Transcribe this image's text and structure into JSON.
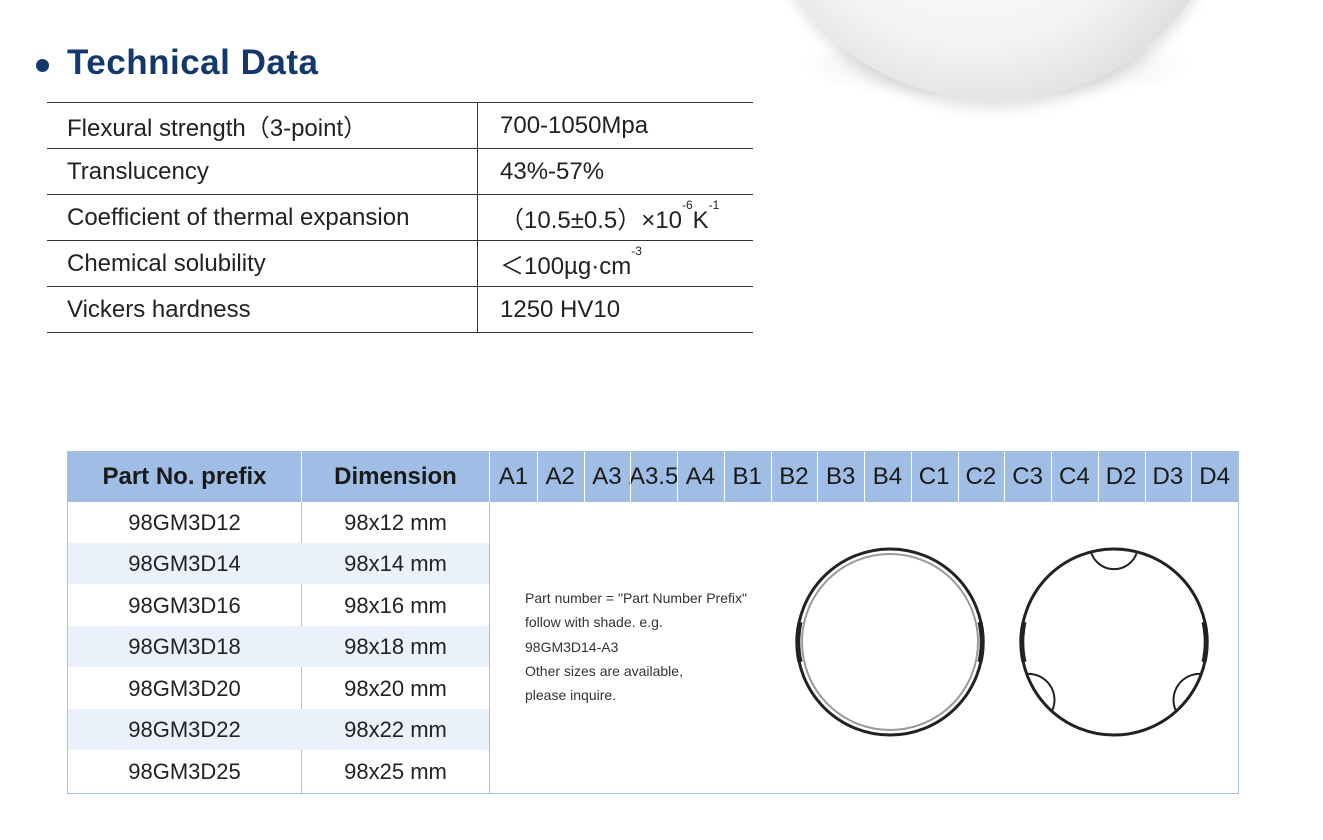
{
  "section": {
    "title": "Technical Data"
  },
  "technical_data": [
    {
      "property": "Flexural strength（3-point）",
      "value": "700-1050Mpa"
    },
    {
      "property": "Translucency",
      "value": "43%-57%"
    },
    {
      "property": "Coefficient of thermal expansion",
      "value_main": "（10.5±0.5）×10",
      "value_sup1": "-6",
      "value_unit": "K",
      "value_sup2": "-1"
    },
    {
      "property": "Chemical solubility",
      "value_main": "＜100µg·cm",
      "value_sup1": "-3"
    },
    {
      "property": "Vickers hardness",
      "value": "1250 HV10"
    }
  ],
  "parts_table": {
    "headers": {
      "prefix": "Part No. prefix",
      "dimension": "Dimension"
    },
    "shades": [
      "A1",
      "A2",
      "A3",
      "A3.5",
      "A4",
      "B1",
      "B2",
      "B3",
      "B4",
      "C1",
      "C2",
      "C3",
      "C4",
      "D2",
      "D3",
      "D4"
    ],
    "rows": [
      {
        "prefix": "98GM3D12",
        "dimension": "98x12 mm"
      },
      {
        "prefix": "98GM3D14",
        "dimension": "98x14 mm"
      },
      {
        "prefix": "98GM3D16",
        "dimension": "98x16 mm"
      },
      {
        "prefix": "98GM3D18",
        "dimension": "98x18 mm"
      },
      {
        "prefix": "98GM3D20",
        "dimension": "98x20 mm"
      },
      {
        "prefix": "98GM3D22",
        "dimension": "98x22 mm"
      },
      {
        "prefix": "98GM3D25",
        "dimension": "98x25 mm"
      }
    ],
    "note": [
      "Part number = \"Part Number Prefix\"",
      "follow with shade. e.g.",
      "98GM3D14-A3",
      "Other sizes are available,",
      "please inquire."
    ]
  },
  "colors": {
    "title": "#12386e",
    "header_bg": "#9fbde5",
    "alt_row": "#eaf1fb",
    "border": "#a9bedc"
  }
}
